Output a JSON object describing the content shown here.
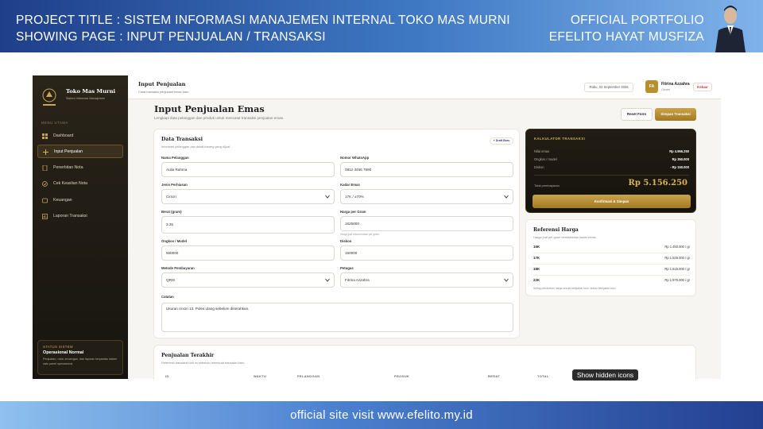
{
  "banner": {
    "project_line": "PROJECT TITLE  : SISTEM INFORMASI MANAJEMEN INTERNAL TOKO MAS MURNI",
    "page_line": "SHOWING PAGE : INPUT PENJUALAN  / TRANSAKSI",
    "portfolio": "OFFICIAL PORTFOLIO",
    "author": "EFELITO HAYAT MUSFIZA"
  },
  "footer": {
    "text": "official site visit www.efelito.my.id"
  },
  "sidebar": {
    "brand_name": "Toko Mas Murni",
    "brand_sub": "Sistem Informasi Manajemen",
    "menu_title": "MENU UTAMA",
    "items": [
      {
        "label": "Dashboard",
        "icon": "grid-icon"
      },
      {
        "label": "Input Penjualan",
        "icon": "plus-icon",
        "active": true
      },
      {
        "label": "Penerbitan Nota",
        "icon": "document-icon"
      },
      {
        "label": "Cek Keaslian Nota",
        "icon": "shield-check-icon"
      },
      {
        "label": "Keuangan",
        "icon": "wallet-icon"
      },
      {
        "label": "Laporan Transaksi",
        "icon": "report-icon"
      }
    ],
    "status": {
      "title": "STATUS SISTEM",
      "value": "Operasional Normal",
      "desc": "Penjualan, nota, keuangan, dan laporan terpantau dalam satu panel operasional."
    }
  },
  "topbar": {
    "title": "Input Penjualan",
    "subtitle": "Catat transaksi penjualan emas baru",
    "date": "Rabu, 02 September 2026",
    "user_initials": "FA",
    "user_name": "Fitrina Azzahra",
    "user_role": "Owner",
    "logout": "Keluar"
  },
  "page": {
    "heading": "Input Penjualan Emas",
    "subheading": "Lengkapi data pelanggan dan produk untuk mencatat transaksi penjualan emas.",
    "reset_label": "Reset Form",
    "save_label": "Simpan Transaksi"
  },
  "form": {
    "title": "Data Transaksi",
    "subtitle": "Informasi pelanggan dan detail barang yang dijual.",
    "badge": "+ Draft Baru",
    "fields": {
      "customer_name": {
        "label": "Nama Pelanggan",
        "value": "Aulia Rahma"
      },
      "whatsapp": {
        "label": "Nomor WhatsApp",
        "value": "0812 3456 7890"
      },
      "jewelry_type": {
        "label": "Jenis Perhiasan",
        "value": "Cincin"
      },
      "gold_grade": {
        "label": "Kadar Emas",
        "value": "17K / ±70%"
      },
      "weight": {
        "label": "Berat (gram)",
        "value": "3.25"
      },
      "price_per_gram": {
        "label": "Harga per Gram",
        "value": "1625000",
        "hint": "Harga jual rekomendasi per gram."
      },
      "fee": {
        "label": "Ongkos / Model",
        "value": "550000"
      },
      "discount": {
        "label": "Diskon",
        "value": "150000"
      },
      "payment": {
        "label": "Metode Pembayaran",
        "value": "QRIS"
      },
      "staff": {
        "label": "Petugas",
        "value": "Fitrina Azzahra"
      },
      "notes": {
        "label": "Catatan",
        "value": "Ukuran cincin 13. Poles ulang sebelum diserahkan."
      }
    }
  },
  "calculator": {
    "title": "KALKULATOR TRANSAKSI",
    "rows": [
      {
        "label": "Nilai emas",
        "value": "Rp 4.956.250"
      },
      {
        "label": "Ongkos / model",
        "value": "Rp 350.000"
      },
      {
        "label": "Diskon",
        "value": "- Rp 150.000"
      }
    ],
    "total_label": "Total pembayaran",
    "total_value": "Rp 5.156.250",
    "confirm_label": "Konfirmasi & Simpan"
  },
  "price_reference": {
    "title": "Referensi Harga",
    "subtitle": "Harga jual per gram berdasarkan kadar emas.",
    "rows": [
      {
        "grade": "16K",
        "price": "Rp 1.450.000 / gr"
      },
      {
        "grade": "17K",
        "price": "Rp 1.525.000 / gr"
      },
      {
        "grade": "18K",
        "price": "Rp 1.615.000 / gr"
      },
      {
        "grade": "22K",
        "price": "Rp 1.975.000 / gr"
      }
    ],
    "note": "Setiap perubahan harga sesuai kebijakan toko, bukan kebijakan toko."
  },
  "recent_sales": {
    "title": "Penjualan Terakhir",
    "subtitle": "Referensi transaksi hari ini sebelum membuat transaksi baru.",
    "columns": [
      "ID",
      "WAKTU",
      "PELANGGAN",
      "PRODUK",
      "BERAT",
      "TOTAL"
    ]
  },
  "tooltip": {
    "text": "Show hidden icons"
  },
  "colors": {
    "gold": "#b88f2e",
    "sidebar_dark": "#1c1812",
    "banner_blue": "#2a56a8"
  }
}
